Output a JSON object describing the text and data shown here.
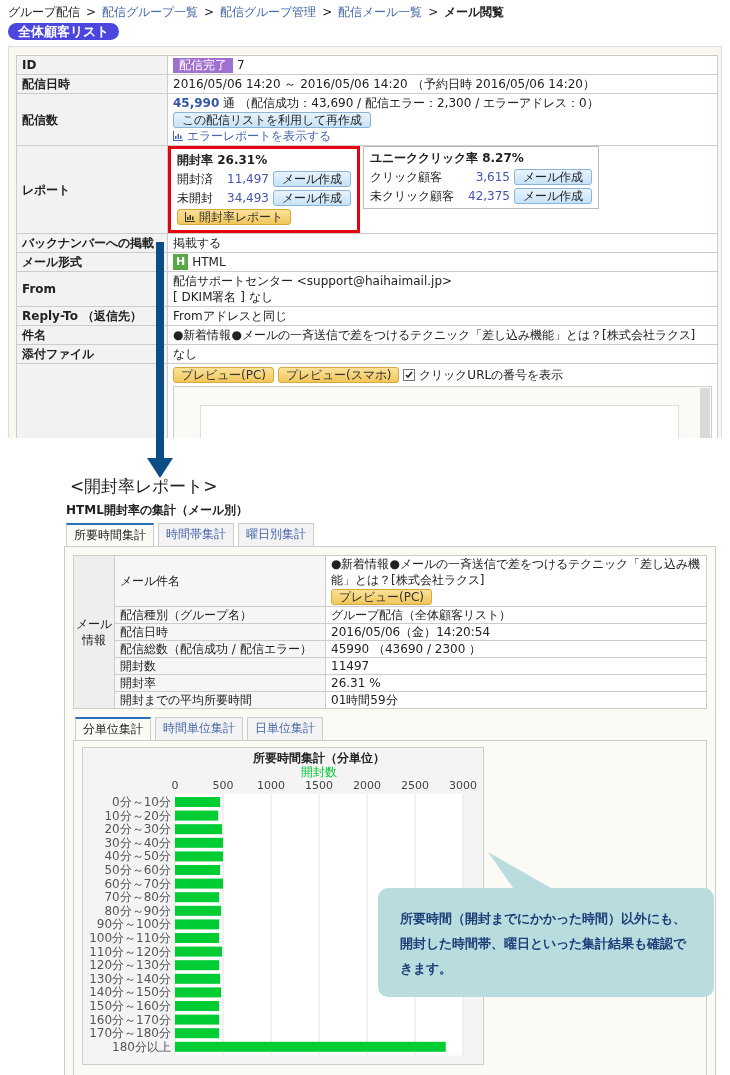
{
  "breadcrumb": {
    "separator": ">",
    "items": [
      {
        "label": "グループ配信",
        "kind": "text"
      },
      {
        "label": "配信グループ一覧",
        "kind": "link"
      },
      {
        "label": "配信グループ管理",
        "kind": "link"
      },
      {
        "label": "配信メール一覧",
        "kind": "link"
      },
      {
        "label": "メール閲覧",
        "kind": "current"
      }
    ]
  },
  "list_badge": "全体顧客リスト",
  "details": {
    "id": {
      "label": "ID",
      "status": "配信完了",
      "value": "7"
    },
    "date": {
      "label": "配信日時",
      "value": "2016/05/06 14:20 ～ 2016/05/06 14:20 （予約日時 2016/05/06 14:20）"
    },
    "count": {
      "label": "配信数",
      "total": "45,990",
      "unit": "通",
      "breakdown": "（配信成功：43,690 / 配信エラー：2,300 / エラーアドレス：0）",
      "button": "この配信リストを利用して再作成",
      "error_link": "エラーレポートを表示する"
    },
    "report": {
      "label": "レポート",
      "boxes": [
        {
          "title": "開封率 26.31%",
          "highlighted": true,
          "rows": [
            {
              "label": "開封済",
              "count": "11,497",
              "button": "メール作成"
            },
            {
              "label": "未開封",
              "count": "34,493",
              "button": "メール作成"
            }
          ],
          "report_button": "開封率レポート"
        },
        {
          "title": "ユニーククリック率 8.27%",
          "highlighted": false,
          "rows": [
            {
              "label": "クリック顧客",
              "count": "3,615",
              "button": "メール作成"
            },
            {
              "label": "未クリック顧客",
              "count": "42,375",
              "button": "メール作成"
            }
          ]
        }
      ]
    },
    "backnumber": {
      "label": "バックナンバーへの掲載",
      "value": "掲載する"
    },
    "format": {
      "label": "メール形式",
      "badge": "H",
      "value": "HTML"
    },
    "from": {
      "label": "From",
      "value": "配信サポートセンター <support@haihaimail.jp>",
      "dkim": "[ DKIM署名 ] なし"
    },
    "reply_to": {
      "label": "Reply-To （返信先）",
      "value": "Fromアドレスと同じ"
    },
    "subject": {
      "label": "件名",
      "value": "●新着情報●メールの一斉送信で差をつけるテクニック「差し込み機能」とは？[株式会社ラクス]"
    },
    "attachment": {
      "label": "添付ファイル",
      "value": "なし"
    },
    "preview": {
      "buttons": [
        "プレビュー(PC)",
        "プレビュー(スマホ)"
      ],
      "checkbox": {
        "label": "クリックURLの番号を表示",
        "checked": true
      }
    }
  },
  "report_heading": "<開封率レポート>",
  "report": {
    "title": "HTML開封率の集計（メール別）",
    "tabs": [
      {
        "label": "所要時間集計",
        "selected": true
      },
      {
        "label": "時間帯集計",
        "selected": false
      },
      {
        "label": "曜日別集計",
        "selected": false
      }
    ],
    "info": {
      "group_label": "メール情報",
      "rows": [
        {
          "label": "メール件名",
          "value": "●新着情報●メールの一斉送信で差をつけるテクニック「差し込み機能」とは？[株式会社ラクス]",
          "button": "プレビュー(PC)"
        },
        {
          "label": "配信種別（グループ名）",
          "value": "グループ配信（全体顧客リスト）"
        },
        {
          "label": "配信日時",
          "value": "2016/05/06（金）14:20:54"
        },
        {
          "label": "配信総数（配信成功 / 配信エラー）",
          "value": "45990 （43690 / 2300 ）"
        },
        {
          "label": "開封数",
          "value": "11497"
        },
        {
          "label": "開封率",
          "value": "26.31 %"
        },
        {
          "label": "開封までの平均所要時間",
          "value": "01時間59分"
        }
      ]
    },
    "subtabs": [
      {
        "label": "分単位集計",
        "selected": true
      },
      {
        "label": "時間単位集計",
        "selected": false
      },
      {
        "label": "日単位集計",
        "selected": false
      }
    ],
    "chart_data": {
      "type": "bar",
      "orientation": "horizontal",
      "title": "所要時間集計（分単位）",
      "categories": [
        "0分～10分",
        "10分～20分",
        "20分～30分",
        "30分～40分",
        "40分～50分",
        "50分～60分",
        "60分～70分",
        "70分～80分",
        "80分～90分",
        "90分～100分",
        "100分～110分",
        "110分～120分",
        "120分～130分",
        "130分～140分",
        "140分～150分",
        "150分～160分",
        "160分～170分",
        "170分～180分",
        "180分以上"
      ],
      "series": [
        {
          "name": "開封数",
          "color": "#00cc33",
          "values": [
            470,
            450,
            490,
            500,
            500,
            470,
            500,
            460,
            480,
            460,
            460,
            490,
            460,
            470,
            480,
            460,
            460,
            460,
            2820
          ]
        }
      ],
      "grid": true,
      "xlim": [
        0,
        3000
      ],
      "xticks": [
        0,
        500,
        1000,
        1500,
        2000,
        2500,
        3000
      ]
    }
  },
  "callout": "所要時間（開封までにかかった時間）以外にも、開封した時間帯、曜日といった集計結果も確認できます。"
}
